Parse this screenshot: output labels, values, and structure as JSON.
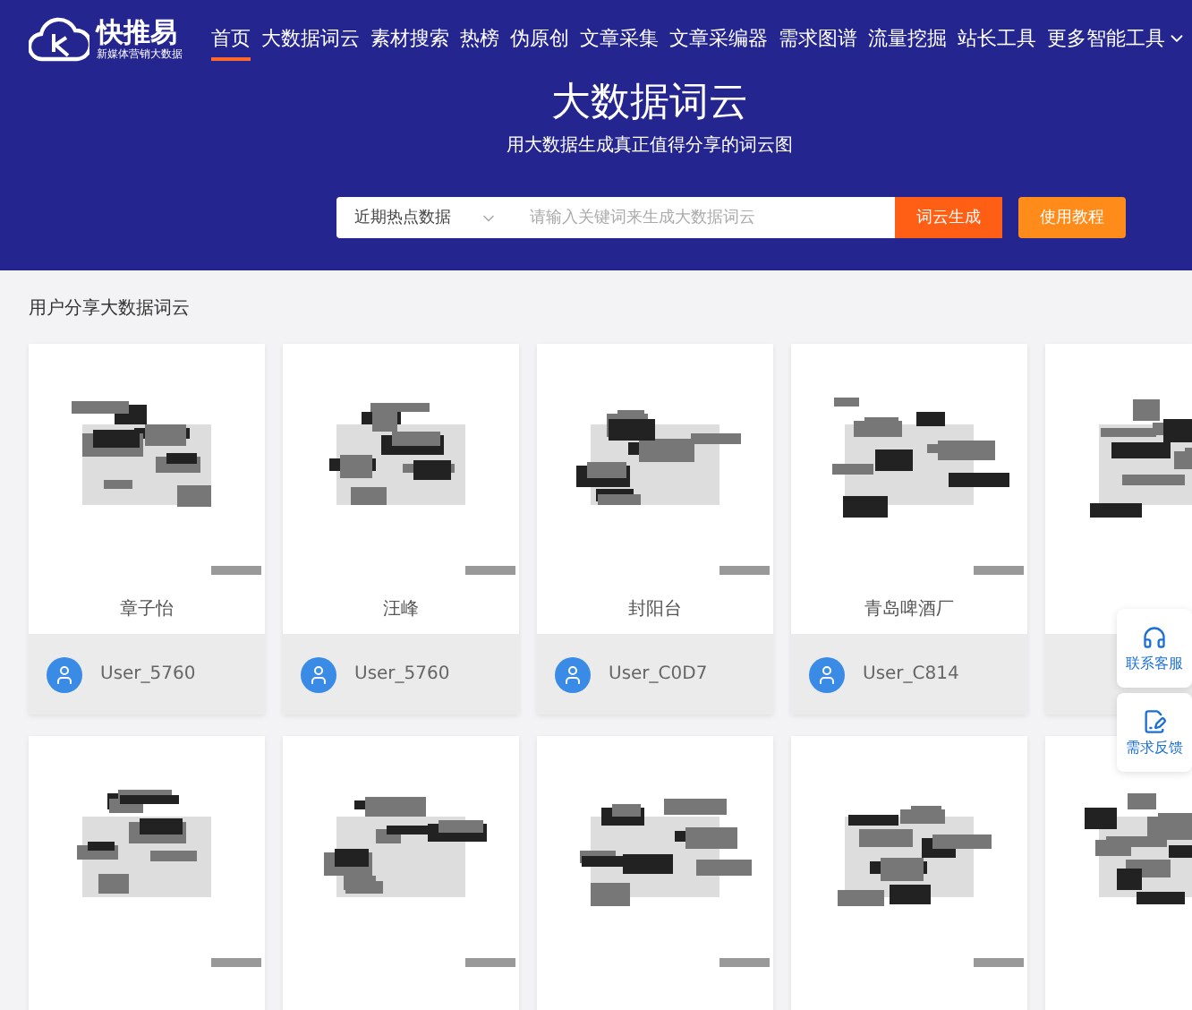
{
  "logo": {
    "name": "快推易",
    "tagline": "新媒体营销大数据"
  },
  "nav": [
    {
      "label": "首页",
      "selected": true
    },
    {
      "label": "大数据词云",
      "selected": false
    },
    {
      "label": "素材搜索",
      "selected": false
    },
    {
      "label": "热榜",
      "selected": false
    },
    {
      "label": "伪原创",
      "selected": false
    },
    {
      "label": "文章采集",
      "selected": false
    },
    {
      "label": "文章采编器",
      "selected": false
    },
    {
      "label": "需求图谱",
      "selected": false
    },
    {
      "label": "流量挖掘",
      "selected": false
    },
    {
      "label": "站长工具",
      "selected": false
    }
  ],
  "more_menu": {
    "label": "更多智能工具"
  },
  "hero": {
    "title": "大数据词云",
    "subtitle": "用大数据生成真正值得分享的词云图"
  },
  "search": {
    "category": "近期热点数据",
    "placeholder": "请输入关键词来生成大数据词云",
    "submit": "词云生成"
  },
  "tutorial_button": "使用教程",
  "section_title": "用户分享大数据词云",
  "cards": [
    {
      "kind": "picture",
      "title": "章子怡",
      "user": "User_5760"
    },
    {
      "kind": "picture",
      "title": "汪峰",
      "user": "User_5760"
    },
    {
      "kind": "picture",
      "title": "封阳台",
      "user": "User_C0D7"
    },
    {
      "kind": "picture",
      "title": "青岛啤酒厂",
      "user": "User_C814"
    },
    {
      "kind": "picture"
    },
    {
      "kind": "picture"
    },
    {
      "kind": "picture"
    },
    {
      "kind": "picture"
    },
    {
      "kind": "picture"
    },
    {
      "kind": "picture"
    }
  ],
  "side_widget": [
    {
      "kind": "service",
      "label": "联系客服"
    },
    {
      "kind": "feedback",
      "label": "需求反馈"
    }
  ]
}
